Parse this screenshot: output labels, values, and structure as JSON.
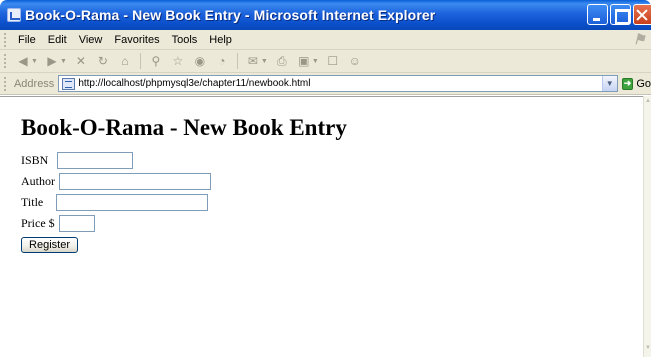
{
  "window": {
    "title": "Book-O-Rama - New Book Entry - Microsoft Internet Explorer",
    "accent_color": "#0a4fc9"
  },
  "menu": {
    "items": [
      "File",
      "Edit",
      "View",
      "Favorites",
      "Tools",
      "Help"
    ]
  },
  "address": {
    "label": "Address",
    "url": "http://localhost/phpmysql3e/chapter11/newbook.html",
    "go_label": "Go"
  },
  "page": {
    "heading": "Book-O-Rama - New Book Entry",
    "fields": {
      "isbn_label": "ISBN",
      "isbn_value": "",
      "author_label": "Author",
      "author_value": "",
      "title_label": "Title",
      "title_value": "",
      "price_label": "Price $",
      "price_value": ""
    },
    "submit_label": "Register"
  }
}
